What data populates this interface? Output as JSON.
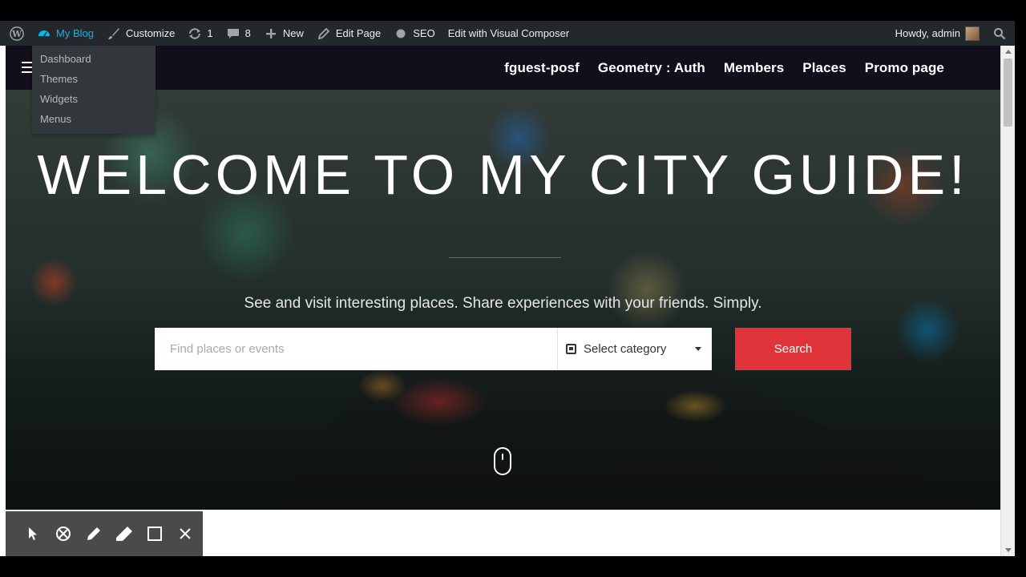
{
  "adminbar": {
    "items": [
      {
        "id": "wp-logo",
        "icon": "wordpress-icon",
        "label": ""
      },
      {
        "id": "my-blog",
        "icon": "dashboard-icon",
        "label": "My Blog"
      },
      {
        "id": "customize",
        "icon": "brush-icon",
        "label": "Customize"
      },
      {
        "id": "updates",
        "icon": "refresh-icon",
        "label": "1"
      },
      {
        "id": "comments",
        "icon": "comment-icon",
        "label": "8"
      },
      {
        "id": "new",
        "icon": "plus-icon",
        "label": "New"
      },
      {
        "id": "edit-page",
        "icon": "pencil-icon",
        "label": "Edit Page"
      },
      {
        "id": "seo",
        "icon": "circle-icon",
        "label": "SEO"
      },
      {
        "id": "visual-composer",
        "icon": "",
        "label": "Edit with Visual Composer"
      }
    ],
    "greeting": "Howdy, admin",
    "dropdown": [
      "Dashboard",
      "Themes",
      "Widgets",
      "Menus"
    ]
  },
  "nav": {
    "links": [
      "fguest-posf",
      "Geometry : Auth",
      "Members",
      "Places",
      "Promo page"
    ]
  },
  "hero": {
    "title": "WELCOME TO MY CITY GUIDE!",
    "subtitle": "See and visit interesting places. Share experiences with your friends. Simply.",
    "search_placeholder": "Find places or events",
    "category_label": "Select category",
    "search_button": "Search"
  },
  "annotation_tools": [
    "cursor-icon",
    "no-entry-icon",
    "pen-icon",
    "marker-icon",
    "rectangle-icon",
    "close-icon"
  ],
  "colors": {
    "accent": "#e0343a",
    "adminbar": "#23282d",
    "nav": "#120f1c",
    "active_link": "#00b9eb"
  }
}
